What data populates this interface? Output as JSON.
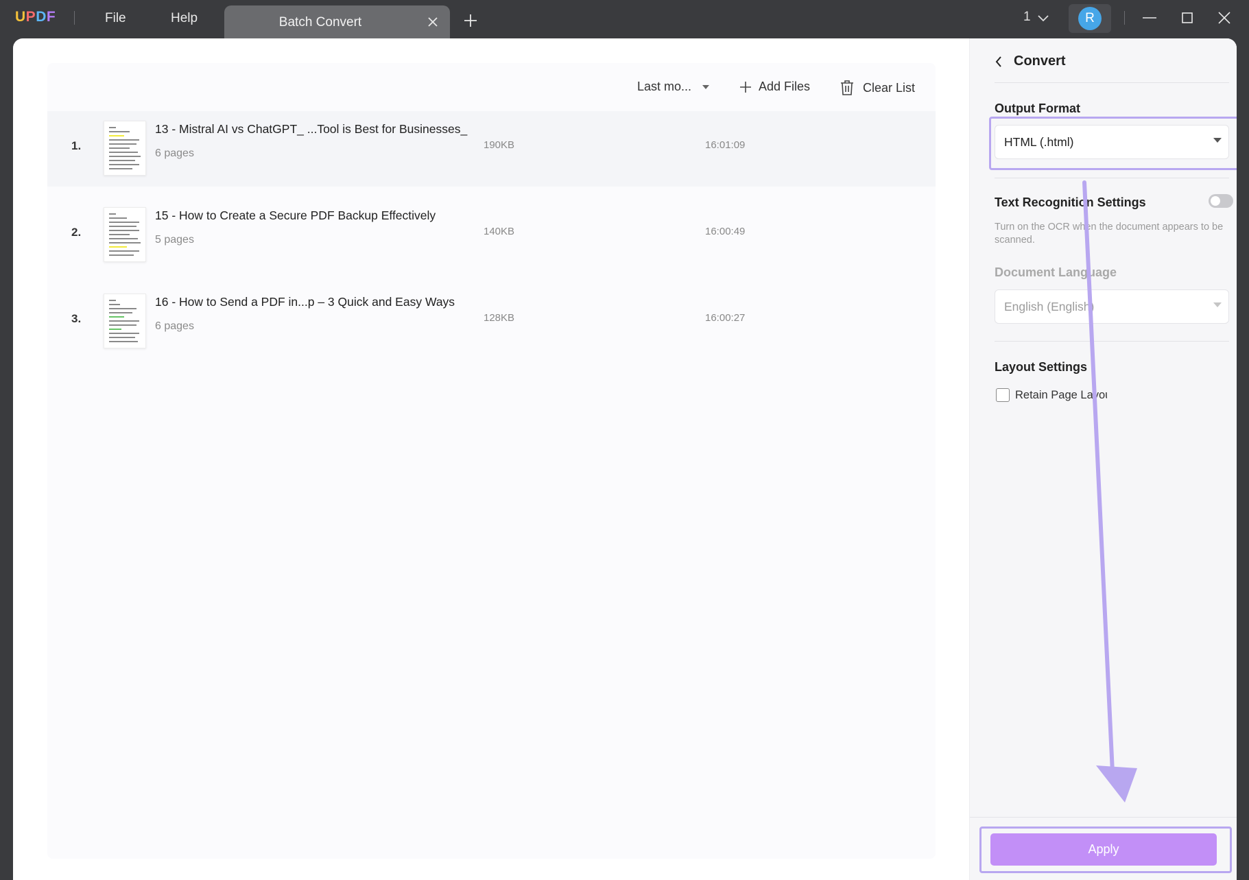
{
  "titlebar": {
    "logo_parts": [
      "U",
      "P",
      "D",
      "F"
    ],
    "menu": [
      "File",
      "Help"
    ],
    "tab_label": "Batch Convert",
    "page_count": "1",
    "avatar_letter": "R"
  },
  "toolbar": {
    "sort_label": "Last mo...",
    "add_files_label": "Add Files",
    "clear_list_label": "Clear List"
  },
  "files": [
    {
      "num": "1.",
      "name": "13 - Mistral AI vs ChatGPT_ ...Tool is Best for Businesses_",
      "pages": "6 pages",
      "size": "190KB",
      "time": "16:01:09"
    },
    {
      "num": "2.",
      "name": "15 - How to Create a Secure PDF Backup Effectively",
      "pages": "5 pages",
      "size": "140KB",
      "time": "16:00:49"
    },
    {
      "num": "3.",
      "name": "16 - How to Send a PDF in...p – 3 Quick and Easy Ways",
      "pages": "6 pages",
      "size": "128KB",
      "time": "16:00:27"
    }
  ],
  "panel": {
    "title": "Convert",
    "output_format_label": "Output Format",
    "output_format_value": "HTML (.html)",
    "ocr_label": "Text Recognition Settings",
    "ocr_enabled": false,
    "ocr_help": "Turn on the OCR when the document appears to be scanned.",
    "doc_language_label": "Document Language",
    "doc_language_value": "English (English)",
    "layout_label": "Layout Settings",
    "retain_layout_label": "Retain Page Layout",
    "retain_layout_checked": false,
    "apply_label": "Apply"
  },
  "colors": {
    "accent": "#c28ff7",
    "highlight": "#b8a7f0",
    "titlebar": "#3a3b3e"
  }
}
